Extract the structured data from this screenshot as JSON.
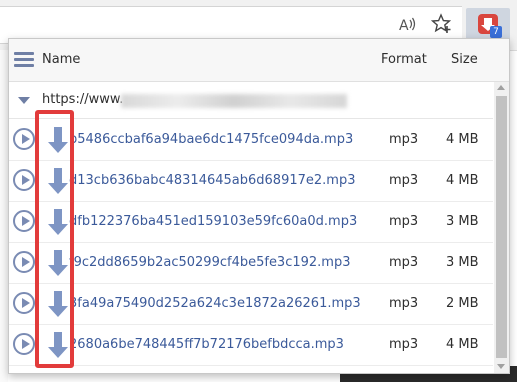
{
  "browser": {
    "read_aloud_glyph": "A",
    "favorites_icon": "star-plus-icon",
    "extension": {
      "icon": "downloader-extension-icon",
      "badge_count": "7",
      "color": "#d9463e",
      "badge_color": "#3a6fd8"
    }
  },
  "popup": {
    "header": {
      "menu_icon": "hamburger-menu-icon",
      "name_label": "Name",
      "format_label": "Format",
      "size_label": "Size"
    },
    "url_row": {
      "prefix": "https://www."
    },
    "files": [
      {
        "name": "b5486ccbaf6a94bae6dc1475fce094da.mp3",
        "format": "mp3",
        "size": "4 MB"
      },
      {
        "name": "d13cb636babc48314645ab6d68917e2.mp3",
        "format": "mp3",
        "size": "4 MB"
      },
      {
        "name": "dfb122376ba451ed159103e59fc60a0d.mp3",
        "format": "mp3",
        "size": "3 MB"
      },
      {
        "name": "f9c2dd8659b2ac50299cf4be5fe3c192.mp3",
        "format": "mp3",
        "size": "3 MB"
      },
      {
        "name": "3fa49a75490d252a624c3e1872a26261.mp3",
        "format": "mp3",
        "size": "2 MB"
      },
      {
        "name": "2680a6be748445ff7b72176befbdcca.mp3",
        "format": "mp3",
        "size": "4 MB"
      }
    ],
    "colors": {
      "accent": "#6f7fa5",
      "link": "#3b5a9a",
      "highlight": "#e23b3b"
    }
  }
}
